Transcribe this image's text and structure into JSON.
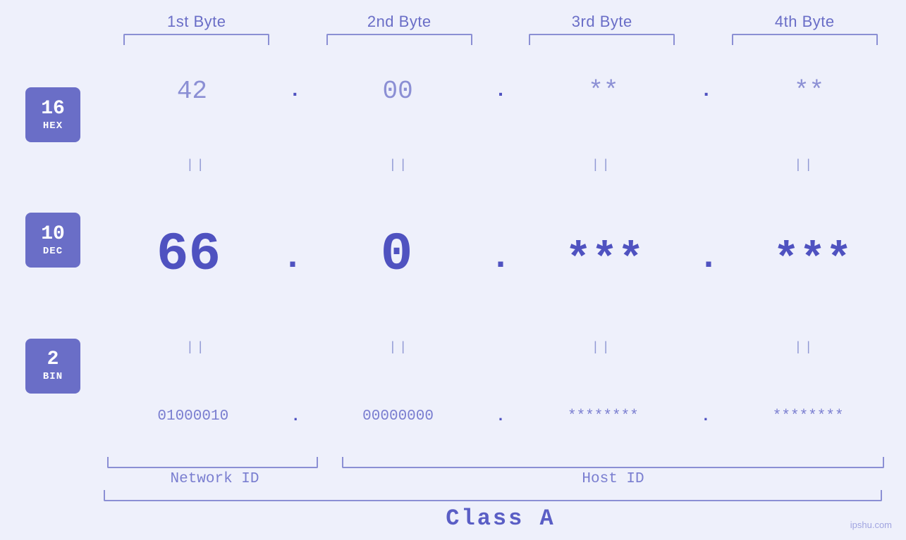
{
  "page": {
    "background": "#eef0fb",
    "watermark": "ipshu.com"
  },
  "bytes": {
    "headers": [
      "1st Byte",
      "2nd Byte",
      "3rd Byte",
      "4th Byte"
    ]
  },
  "bases": [
    {
      "number": "16",
      "label": "HEX"
    },
    {
      "number": "10",
      "label": "DEC"
    },
    {
      "number": "2",
      "label": "BIN"
    }
  ],
  "rows": {
    "hex": {
      "values": [
        "42",
        "00",
        "**",
        "**"
      ],
      "dots": [
        ".",
        ".",
        ".",
        ""
      ]
    },
    "dec": {
      "values": [
        "66",
        "0",
        "***",
        "***"
      ],
      "dots": [
        ".",
        ".",
        ".",
        ""
      ]
    },
    "bin": {
      "values": [
        "01000010",
        "00000000",
        "********",
        "********"
      ],
      "dots": [
        ".",
        ".",
        ".",
        ""
      ]
    }
  },
  "labels": {
    "networkId": "Network ID",
    "hostId": "Host ID",
    "classA": "Class A",
    "equals": "||"
  }
}
